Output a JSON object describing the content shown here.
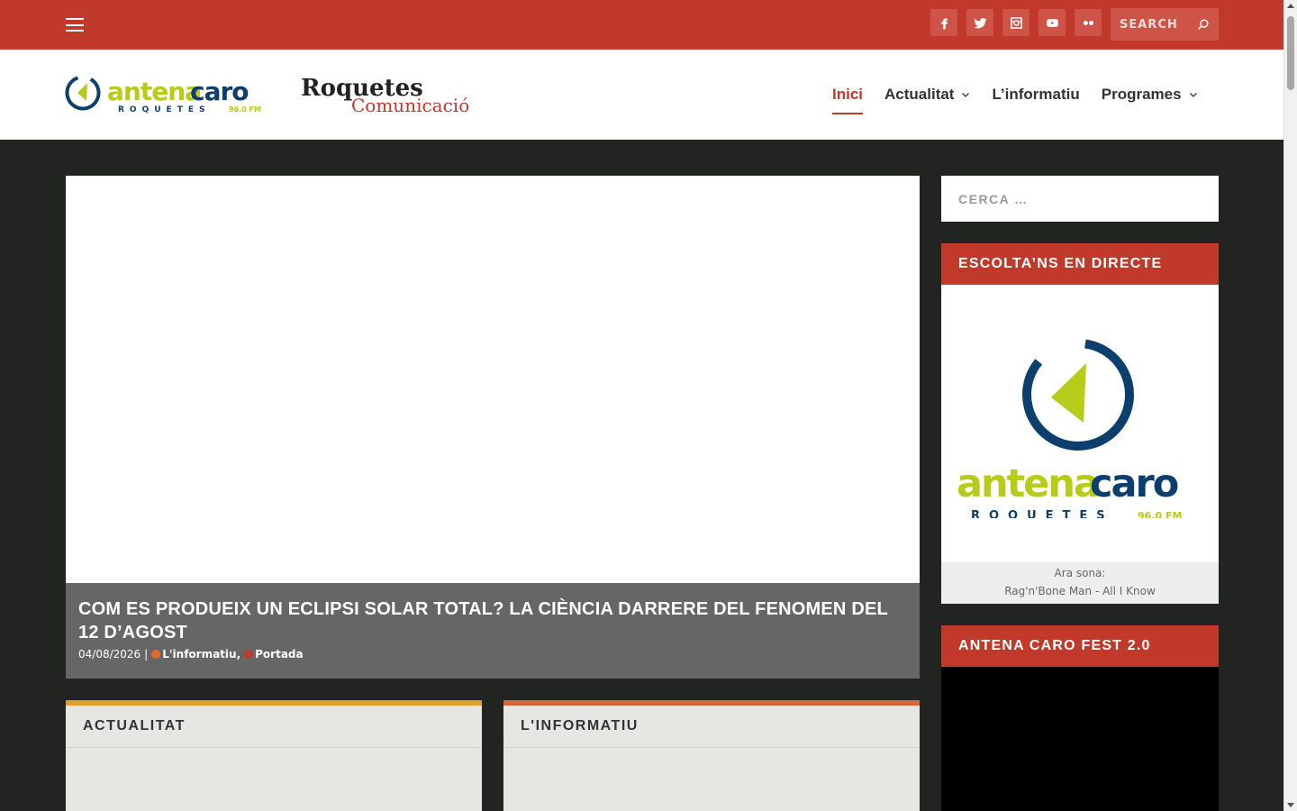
{
  "topbar": {
    "menu_icon": "hamburger-menu-icon",
    "socials": [
      {
        "name": "facebook",
        "icon": "facebook-icon"
      },
      {
        "name": "twitter",
        "icon": "twitter-icon"
      },
      {
        "name": "instagram",
        "icon": "instagram-icon"
      },
      {
        "name": "youtube",
        "icon": "youtube-icon"
      },
      {
        "name": "flickr",
        "icon": "flickr-icon"
      }
    ],
    "search_placeholder": "SEARCH"
  },
  "header": {
    "logo_antena": {
      "word1": "antena",
      "word2": "caro",
      "sub": "ROQUETES",
      "freq": "96.0 FM"
    },
    "logo_roquetes": {
      "line1": "Roquetes",
      "line2": "Comunicació"
    },
    "nav": [
      {
        "label": "Inici",
        "active": true,
        "dropdown": false
      },
      {
        "label": "Actualitat",
        "active": false,
        "dropdown": true
      },
      {
        "label": "L’informatiu",
        "active": false,
        "dropdown": false
      },
      {
        "label": "Programes",
        "active": false,
        "dropdown": true
      }
    ]
  },
  "featured": {
    "title": "COM ES PRODUEIX UN ECLIPSI SOLAR TOTAL? LA CIÈNCIA DARRERE DEL FENOMEN DEL 12 D’AGOST",
    "date": "04/08/2026",
    "separator": "|",
    "categories": [
      {
        "label": "L'informatiu",
        "color": "#e06b2a"
      },
      {
        "label": "Portada",
        "color": "#c0392b"
      }
    ]
  },
  "boxes": [
    {
      "title": "ACTUALITAT",
      "color": "#e0a030"
    },
    {
      "title": "L'INFORMATIU",
      "color": "#d4683a"
    }
  ],
  "sidebar": {
    "search_placeholder": "CERCA …",
    "radio_widget": {
      "title": "ESCOLTA’NS EN DIRECTE",
      "now_label": "Ara sona:",
      "now_playing": "Rag'n'Bone Man - All I Know"
    },
    "fest_widget": {
      "title": "ANTENA CARO FEST 2.0"
    }
  },
  "colors": {
    "brand_red": "#c0392b",
    "dark_bg": "#222422",
    "logo_blue": "#0d3f6e",
    "logo_green": "#b5cc18"
  }
}
